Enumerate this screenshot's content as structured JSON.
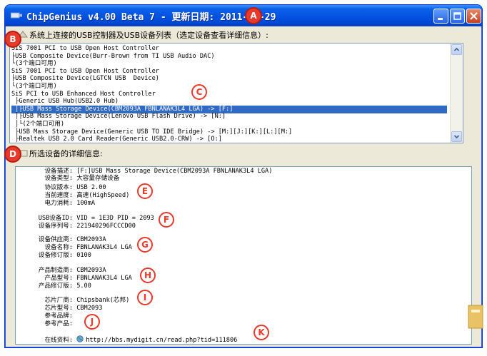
{
  "window": {
    "title": "ChipGenius v4.00 Beta 7 - 更新日期: 2011-09-29",
    "colors": {
      "titlebar": "#0554e3",
      "selection": "#316ac5",
      "callout": "#e8392a"
    }
  },
  "device_list": {
    "label": "系统上连接的USB控制器及USB设备列表（选定设备查看详细信息）:",
    "items": [
      "SiS 7001 PCI to USB Open Host Controller",
      "├USB Composite Device(Burr-Brown from TI USB Audio DAC)",
      "└(3个端口可用)",
      "SiS 7001 PCI to USB Open Host Controller",
      "├USB Composite Device(LGTCN USB  Device)",
      "└(3个端口可用)",
      "SiS PCI to USB Enhanced Host Controller",
      " ├Generic USB Hub(USB2.0 Hub)",
      " │├USB Mass Storage Device(CBM2093A FBNLANAK3L4 LGA) -> [F:]",
      " │├USB Mass Storage Device(Lenovo USB Flash Drive) -> [N:]",
      " │└(2个端口可用)",
      " ├USB Mass Storage Device(Generic USB TO IDE Bridge) -> [M:][J:][K:][L:][M:]",
      " ├Realtek USB 2.0 Card Reader(Generic USB2.0-CRW) -> [O:]"
    ],
    "selected_index": 8
  },
  "details": {
    "label": "所选设备的详细信息:",
    "rows": [
      {
        "label": "设备描述:",
        "value": "[F:]USB Mass Storage Device(CBM2093A FBNLANAK3L4 LGA)"
      },
      {
        "label": "设备类型:",
        "value": "大容量存储设备"
      },
      {
        "label": "协议版本:",
        "value": "USB 2.00"
      },
      {
        "label": "当前速度:",
        "value": "高速(HighSpeed)"
      },
      {
        "label": "电力消耗:",
        "value": "100mA"
      },
      {
        "label": "USB设备ID:",
        "value": "VID = 1E3D PID = 2093"
      },
      {
        "label": "设备序列号:",
        "value": "221940296FCCCD00"
      },
      {
        "label": "设备供应商:",
        "value": "CBM2093A"
      },
      {
        "label": "设备名称:",
        "value": "FBNLANAK3L4 LGA"
      },
      {
        "label": "设备修订版:",
        "value": "0100"
      },
      {
        "label": "产品制造商:",
        "value": "CBM2093A"
      },
      {
        "label": "产品型号:",
        "value": "FBNLANAK3L4 LGA"
      },
      {
        "label": "产品修订版:",
        "value": "5.00"
      },
      {
        "label": "芯片厂商:",
        "value": "Chipsbank(芯邦)"
      },
      {
        "label": "芯片型号:",
        "value": "CBM2093"
      },
      {
        "label": "参考品牌:",
        "value": ""
      },
      {
        "label": "参考产品:",
        "value": ""
      },
      {
        "label": "在线资料:",
        "value": "http://bbs.mydigit.cn/read.php?tid=111806"
      }
    ]
  },
  "callouts": [
    "A",
    "B",
    "C",
    "D",
    "E",
    "F",
    "G",
    "H",
    "I",
    "J",
    "K"
  ]
}
